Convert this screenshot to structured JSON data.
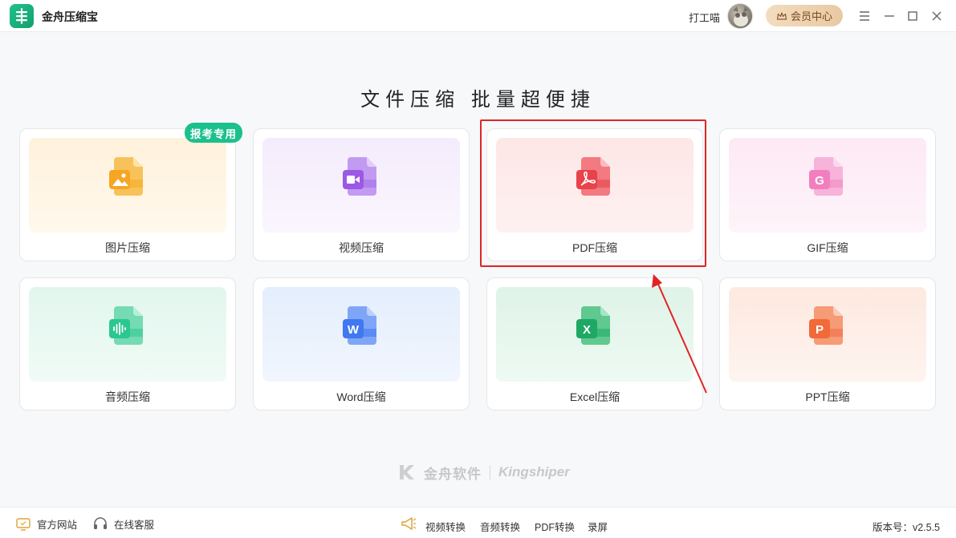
{
  "app": {
    "name": "金舟压缩宝"
  },
  "user": {
    "name": "打工喵"
  },
  "header": {
    "vip_label": "会员中心"
  },
  "headline": "文件压缩  批量超便捷",
  "cards": [
    {
      "label": "图片压缩",
      "badge": "报考专用",
      "accent": "#f5a623"
    },
    {
      "label": "视频压缩",
      "accent": "#9b59e6"
    },
    {
      "label": "PDF压缩",
      "accent": "#e8424a"
    },
    {
      "label": "GIF压缩",
      "accent": "#f17fbf"
    },
    {
      "label": "音频压缩",
      "accent": "#2cc691"
    },
    {
      "label": "Word压缩",
      "accent": "#3f78f0"
    },
    {
      "label": "Excel压缩",
      "accent": "#1ea864"
    },
    {
      "label": "PPT压缩",
      "accent": "#f06a3a"
    }
  ],
  "watermark": {
    "cn": "金舟软件",
    "en": "Kingshiper"
  },
  "footer": {
    "website": "官方网站",
    "support": "在线客服",
    "links": [
      "视频转换",
      "音频转换",
      "PDF转换",
      "录屏"
    ],
    "version": "版本号：v2.5.5"
  }
}
